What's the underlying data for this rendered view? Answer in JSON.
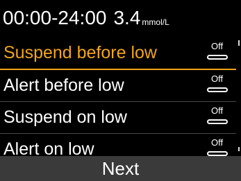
{
  "header": {
    "time_range": "00:00-24:00",
    "value": "3.4",
    "unit": "mmol/L"
  },
  "items": [
    {
      "label": "Suspend before low",
      "state": "Off"
    },
    {
      "label": "Alert before low",
      "state": "Off"
    },
    {
      "label": "Suspend on low",
      "state": "Off"
    },
    {
      "label": "Alert on low",
      "state": "Off"
    }
  ],
  "next_label": "Next",
  "colors": {
    "accent": "#f2a51a",
    "background": "#000000",
    "button": "#3a3a3a"
  }
}
